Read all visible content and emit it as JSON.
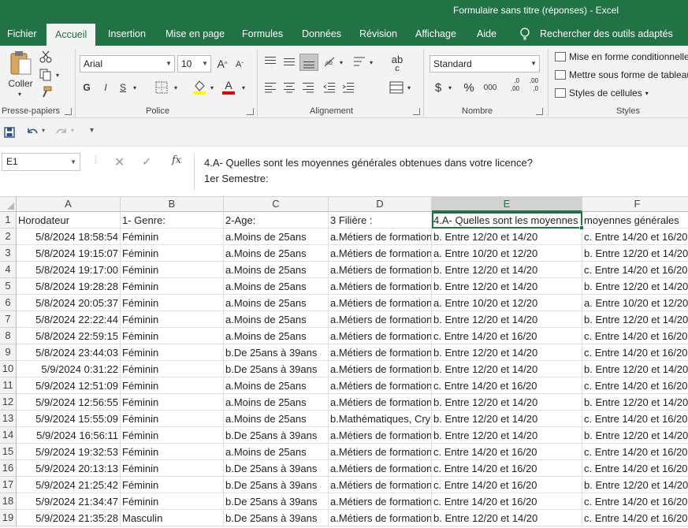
{
  "window": {
    "title": "Formulaire sans titre (réponses)  -  Excel"
  },
  "tabs": [
    "Fichier",
    "Accueil",
    "Insertion",
    "Mise en page",
    "Formules",
    "Données",
    "Révision",
    "Affichage",
    "Aide"
  ],
  "tell_me": "Rechercher des outils adaptés",
  "ribbon": {
    "paste_label": "Coller",
    "clipboard_label": "Presse-papiers",
    "font_name": "Arial",
    "font_size": "10",
    "grow_font": "A",
    "shrink_font": "A",
    "bold": "G",
    "italic": "I",
    "underline": "S",
    "font_color_letter": "A",
    "font_label": "Police",
    "align_label": "Alignement",
    "wrap_glyph": "ab",
    "wrap_sub": "c",
    "number_format": "Standard",
    "currency": "$",
    "percent": "%",
    "thousands": "000",
    "inc_dec_top": ",0",
    "inc_dec_bottom": ",00",
    "dec_dec_top": ",00",
    "dec_dec_bottom": ",0",
    "number_label": "Nombre",
    "cond_format": "Mise en forme conditionnelle",
    "format_table": "Mettre sous forme de tableau",
    "cell_styles": "Styles de cellules",
    "styles_label": "Styles"
  },
  "formula_bar": {
    "name_box": "E1",
    "fx": "fx",
    "formula_line1": "4.A- Quelles sont les moyennes générales obtenues dans votre licence?",
    "formula_line2": "1er Semestre:"
  },
  "grid": {
    "columns": [
      "A",
      "B",
      "C",
      "D",
      "E",
      "F"
    ],
    "rows": [
      [
        "Horodateur",
        "1- Genre:",
        "2-Age:",
        "3 Filière :",
        "4.A- Quelles sont les moyennes",
        "moyennes générales"
      ],
      [
        "5/8/2024 18:58:54",
        "Féminin",
        "a.Moins de 25ans",
        "a.Métiers de formation",
        "b. Entre 12/20 et 14/20",
        "c. Entre 14/20 et 16/20"
      ],
      [
        "5/8/2024 19:15:07",
        "Féminin",
        "a.Moins de 25ans",
        "a.Métiers de formation",
        "a. Entre 10/20 et 12/20",
        "b. Entre 12/20 et 14/20"
      ],
      [
        "5/8/2024 19:17:00",
        "Féminin",
        "a.Moins de 25ans",
        "a.Métiers de formation",
        "b. Entre 12/20 et 14/20",
        "c. Entre 14/20 et 16/20"
      ],
      [
        "5/8/2024 19:28:28",
        "Féminin",
        "a.Moins de 25ans",
        "a.Métiers de formation",
        "b. Entre 12/20 et 14/20",
        "b. Entre 12/20 et 14/20"
      ],
      [
        "5/8/2024 20:05:37",
        "Féminin",
        "a.Moins de 25ans",
        "a.Métiers de formation",
        "a. Entre 10/20 et 12/20",
        "a. Entre 10/20 et 12/20"
      ],
      [
        "5/8/2024 22:22:44",
        "Féminin",
        "a.Moins de 25ans",
        "a.Métiers de formation",
        "b. Entre 12/20 et 14/20",
        "b. Entre 12/20 et 14/20"
      ],
      [
        "5/8/2024 22:59:15",
        "Féminin",
        "a.Moins de 25ans",
        "a.Métiers de formation",
        "c. Entre 14/20 et 16/20",
        "c. Entre 14/20 et 16/20"
      ],
      [
        "5/8/2024 23:44:03",
        "Féminin",
        "b.De 25ans à 39ans",
        "a.Métiers de formation",
        "b. Entre 12/20 et 14/20",
        "c. Entre 14/20 et 16/20"
      ],
      [
        "5/9/2024 0:31:22",
        "Féminin",
        "b.De 25ans à 39ans",
        "a.Métiers de formation",
        "b. Entre 12/20 et 14/20",
        "b. Entre 12/20 et 14/20"
      ],
      [
        "5/9/2024 12:51:09",
        "Féminin",
        "a.Moins de 25ans",
        "a.Métiers de formation",
        "c. Entre 14/20 et 16/20",
        "c. Entre 14/20 et 16/20"
      ],
      [
        "5/9/2024 12:56:55",
        "Féminin",
        "a.Moins de 25ans",
        "a.Métiers de formation",
        "b. Entre 12/20 et 14/20",
        "b. Entre 12/20 et 14/20"
      ],
      [
        "5/9/2024 15:55:09",
        "Féminin",
        "a.Moins de 25ans",
        "b.Mathématiques, Cry",
        "b. Entre 12/20 et 14/20",
        "c. Entre 14/20 et 16/20"
      ],
      [
        "5/9/2024 16:56:11",
        "Féminin",
        "b.De 25ans à 39ans",
        "a.Métiers de formation",
        "b. Entre 12/20 et 14/20",
        "b. Entre 12/20 et 14/20"
      ],
      [
        "5/9/2024 19:32:53",
        "Féminin",
        "a.Moins de 25ans",
        "a.Métiers de formation",
        "c. Entre 14/20 et 16/20",
        "c. Entre 14/20 et 16/20"
      ],
      [
        "5/9/2024 20:13:13",
        "Féminin",
        "b.De 25ans à 39ans",
        "a.Métiers de formation",
        "c. Entre 14/20 et 16/20",
        "c. Entre 14/20 et 16/20"
      ],
      [
        "5/9/2024 21:25:42",
        "Féminin",
        "b.De 25ans à 39ans",
        "a.Métiers de formation",
        "c. Entre 14/20 et 16/20",
        "b. Entre 12/20 et 14/20"
      ],
      [
        "5/9/2024 21:34:47",
        "Féminin",
        "b.De 25ans à 39ans",
        "a.Métiers de formation",
        "c. Entre 14/20 et 16/20",
        "c. Entre 14/20 et 16/20"
      ],
      [
        "5/9/2024 21:35:28",
        "Masculin",
        "b.De 25ans à 39ans",
        "a.Métiers de formation",
        "b. Entre 12/20 et 14/20",
        "c. Entre 14/20 et 16/20"
      ]
    ]
  },
  "colors": {
    "excel_green": "#217346",
    "ribbon_bg": "#f3f3f3"
  }
}
